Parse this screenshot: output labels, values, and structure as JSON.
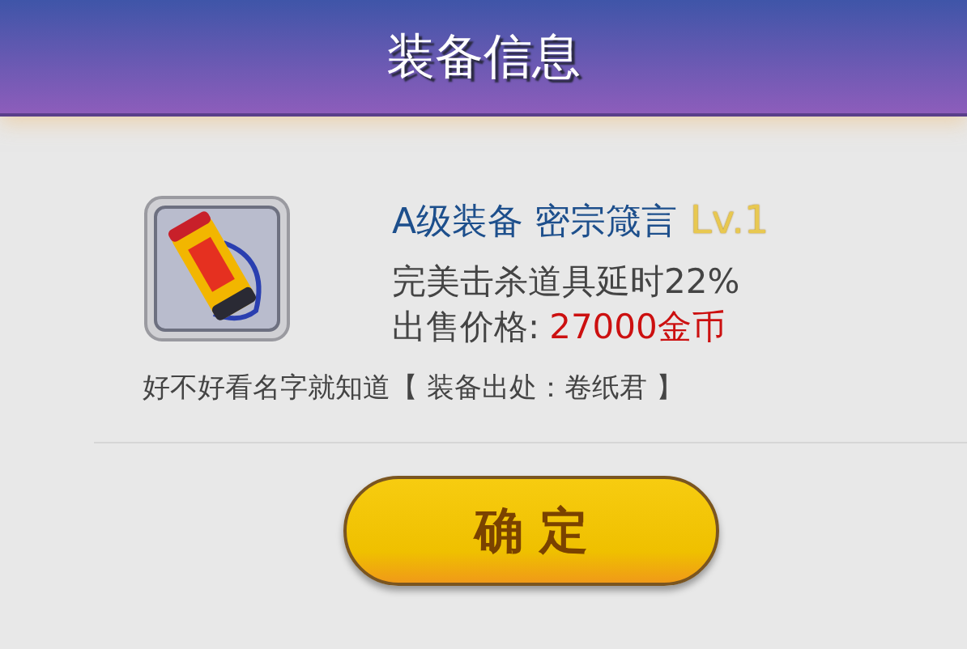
{
  "window": {
    "title": "装备信息"
  },
  "item": {
    "grade_name": "A级装备 密宗箴言",
    "level": "Lv.1",
    "effect": "完美击杀道具延时22%",
    "price_label": "出售价格:",
    "price": "27000金币",
    "description": "好不好看名字就知道【 装备出处：卷纸君 】"
  },
  "buttons": [
    {
      "label": "确 定"
    }
  ]
}
